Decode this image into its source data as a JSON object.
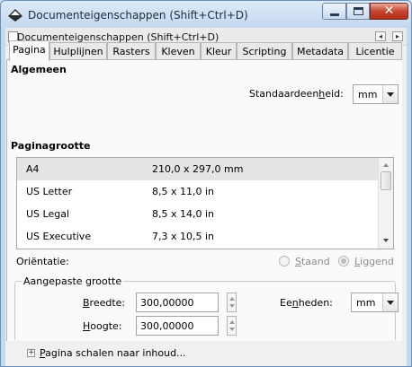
{
  "window": {
    "title": "Documenteigenschappen (Shift+Ctrl+D)",
    "close_glyph": "✕"
  },
  "dock": {
    "title": "Documenteigenschappen (Shift+Ctrl+D)",
    "btn1": "◂",
    "btn2": "▸"
  },
  "tabs": [
    {
      "label": "Pagina"
    },
    {
      "label": "Hulplijnen"
    },
    {
      "label": "Rasters"
    },
    {
      "label": "Kleven"
    },
    {
      "label": "Kleur"
    },
    {
      "label": "Scripting"
    },
    {
      "label": "Metadata"
    },
    {
      "label": "Licentie"
    }
  ],
  "general": {
    "heading": "Algemeen",
    "unit_label_a": "Standaardeen",
    "unit_label_mn": "h",
    "unit_label_b": "eid:",
    "unit_value": "mm"
  },
  "page_size": {
    "heading": "Paginagrootte",
    "rows": [
      {
        "name": "A4",
        "size": "210,0 x 297,0 mm"
      },
      {
        "name": "US Letter",
        "size": "8,5 x 11,0 in"
      },
      {
        "name": "US Legal",
        "size": "8,5 x 14,0 in"
      },
      {
        "name": "US Executive",
        "size": "7,3 x 10,5 in"
      }
    ]
  },
  "orientation": {
    "label": "Oriëntatie:",
    "portrait_mn": "S",
    "portrait_rest": "taand",
    "landscape_mn": "L",
    "landscape_rest": "iggend"
  },
  "custom": {
    "frame_label": "Aangepaste grootte",
    "width_label_mn": "B",
    "width_label_rest": "reedte:",
    "width_value": "300,00000",
    "height_label_mn": "H",
    "height_label_rest": "oogte:",
    "height_value": "300,00000",
    "units_label_a": "Ee",
    "units_label_mn": "n",
    "units_label_b": "heden:",
    "units_value": "mm"
  },
  "scale": {
    "expander_glyph": "+",
    "label_mn": "P",
    "label_rest": "agina schalen naar inhoud..."
  },
  "colors": {
    "close_red": "#c7452e",
    "selected_row": "#e4e4e4"
  }
}
